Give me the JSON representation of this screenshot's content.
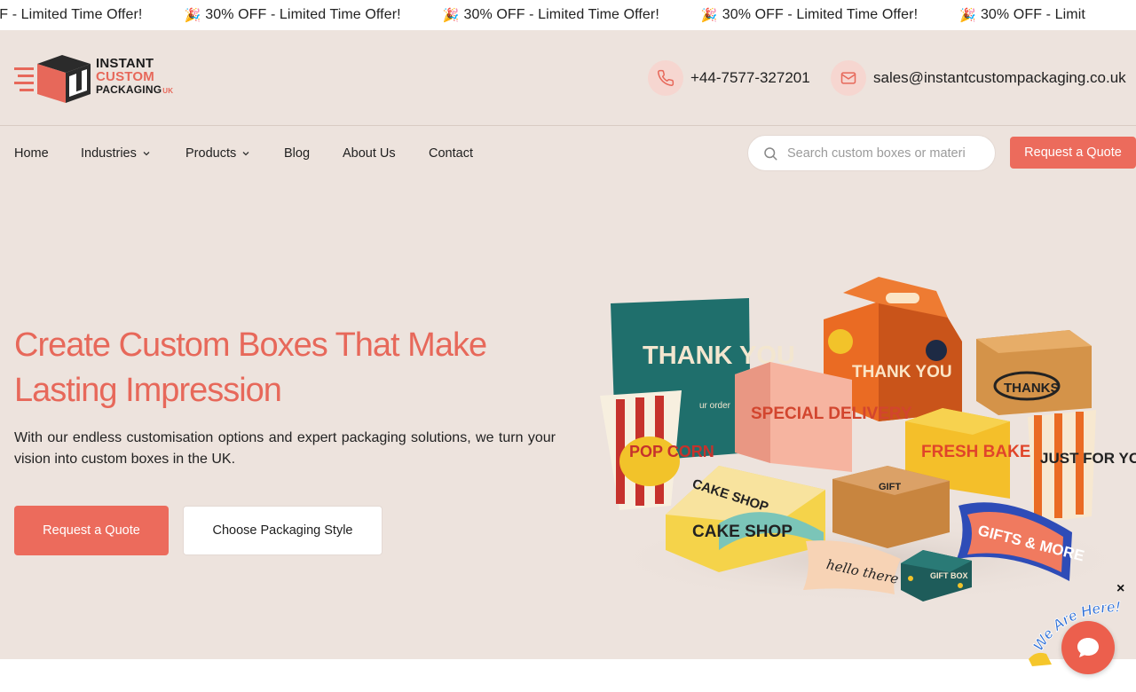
{
  "ticker": {
    "items": [
      "% OFF - Limited Time Offer!",
      "30% OFF - Limited Time Offer!",
      "30% OFF - Limited Time Offer!",
      "30% OFF - Limited Time Offer!",
      "30% OFF - Limit"
    ],
    "emoji": "🎉"
  },
  "header": {
    "logo": {
      "line1": "INSTANT",
      "line2": "CUSTOM",
      "line3": "PACKAGING",
      "suffix": "UK"
    },
    "phone": "+44-7577-327201",
    "email": "sales@instantcustompackaging.co.uk"
  },
  "nav": {
    "items": [
      {
        "label": "Home",
        "dropdown": false
      },
      {
        "label": "Industries",
        "dropdown": true
      },
      {
        "label": "Products",
        "dropdown": true
      },
      {
        "label": "Blog",
        "dropdown": false
      },
      {
        "label": "About Us",
        "dropdown": false
      },
      {
        "label": "Contact",
        "dropdown": false
      }
    ],
    "search_placeholder": "Search custom boxes or materials...",
    "quote_button": "Request a Quote"
  },
  "hero": {
    "title_line1": "Create Custom Boxes That Make",
    "title_line2": "Lasting Impression",
    "subtitle": "With our endless customisation options and expert packaging solutions, we turn your vision into custom boxes in the UK.",
    "primary_button": "Request a Quote",
    "secondary_button": "Choose Packaging Style",
    "box_labels": [
      "THANK YOU",
      "ur order",
      "THANK YOU",
      "THANKS",
      "SPECIAL DELIVERY",
      "POP CORN",
      "FRESH BAKES",
      "JUST FOR YOU",
      "CAKE SHOP",
      "CAKE SHOP",
      "GIFT",
      "GIFTS & MORE",
      "hello there",
      "GIFT BOX"
    ]
  },
  "chat": {
    "close": "×",
    "banner": "We Are Here!"
  },
  "colors": {
    "accent": "#ec6b5c",
    "background": "#ede3dd",
    "title": "#e7685a"
  }
}
